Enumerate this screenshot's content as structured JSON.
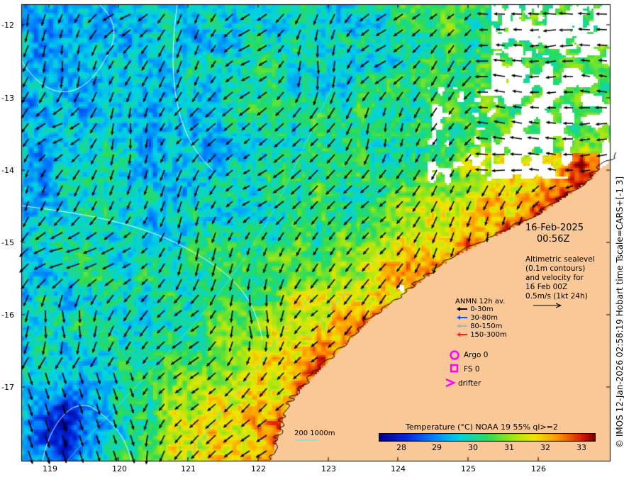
{
  "date": "16-Feb-2025",
  "time": "00:56Z",
  "altimetry_note": [
    "Altimetric sealevel",
    "(0.1m contours)",
    "and velocity for",
    "16 Feb 00Z",
    "0.5m/s (1kt 24h)"
  ],
  "anmn": {
    "title": "ANMN 12h av.",
    "items": [
      {
        "label": "0-30m",
        "color": "#000000"
      },
      {
        "label": "30-80m",
        "color": "#0055ff"
      },
      {
        "label": "80-150m",
        "color": "#b0b0b0"
      },
      {
        "label": "150-300m",
        "color": "#ff2020"
      }
    ]
  },
  "symbols": {
    "argo": "Argo 0",
    "fs": "FS 0",
    "drifter": "drifter",
    "color": "#ff00ff"
  },
  "colorbar": {
    "title": "Temperature (°C) NOAA 19 55% ql>=2",
    "ticks": [
      "28",
      "29",
      "30",
      "31",
      "32",
      "33"
    ],
    "range": [
      27.5,
      33.5
    ]
  },
  "bathy_legend": "200  1000m",
  "credit": "© IMOS 12-Jan-2026 02:58:19 Hobart time Tscale=CARS+[-1 3]",
  "axes": {
    "lat_ticks": [
      "-12",
      "-13",
      "-14",
      "-15",
      "-16",
      "-17"
    ],
    "lon_ticks": [
      "119",
      "120",
      "121",
      "122",
      "123",
      "124",
      "125",
      "126"
    ]
  },
  "colors": {
    "land": "#fac896",
    "cloud": "#ffffff"
  }
}
